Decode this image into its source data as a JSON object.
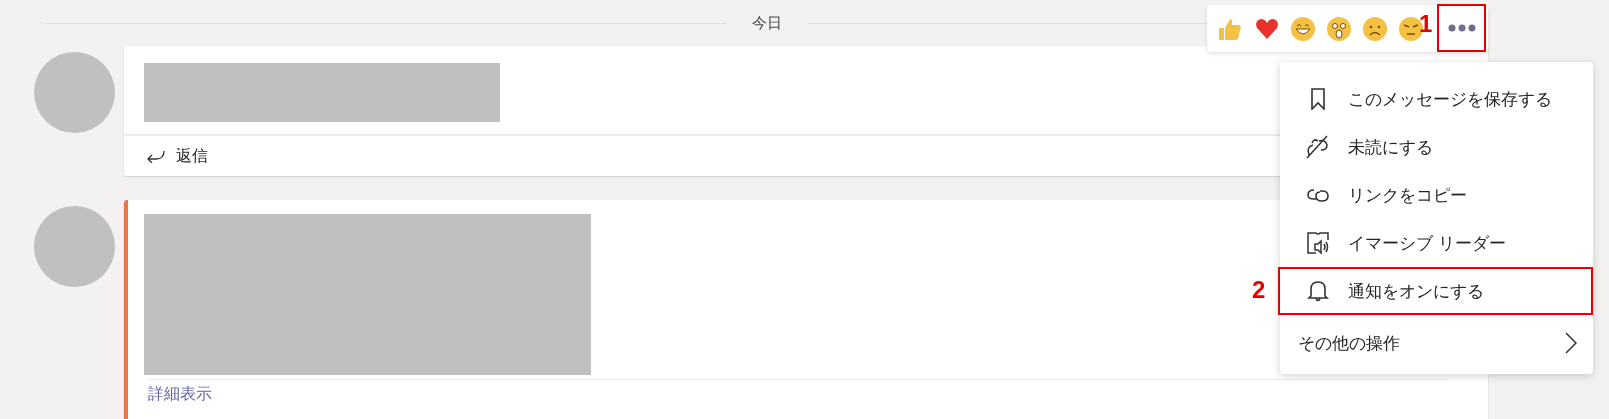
{
  "date_divider": {
    "label": "今日"
  },
  "messages": [
    {
      "accent": false,
      "reply_label": "返信"
    },
    {
      "accent": true,
      "expand_label": "詳細表示"
    }
  ],
  "reactions": {
    "more_marked": true,
    "callout": "1"
  },
  "menu": {
    "items": [
      {
        "kind": "bookmark",
        "label": "このメッセージを保存する",
        "marked": false
      },
      {
        "kind": "unread",
        "label": "未読にする",
        "marked": false
      },
      {
        "kind": "link",
        "label": "リンクをコピー",
        "marked": false
      },
      {
        "kind": "reader",
        "label": "イマーシブ リーダー",
        "marked": false
      },
      {
        "kind": "bell",
        "label": "通知をオンにする",
        "marked": true
      },
      {
        "kind": "submenu",
        "label": "その他の操作",
        "marked": false
      }
    ],
    "callout": "2"
  }
}
